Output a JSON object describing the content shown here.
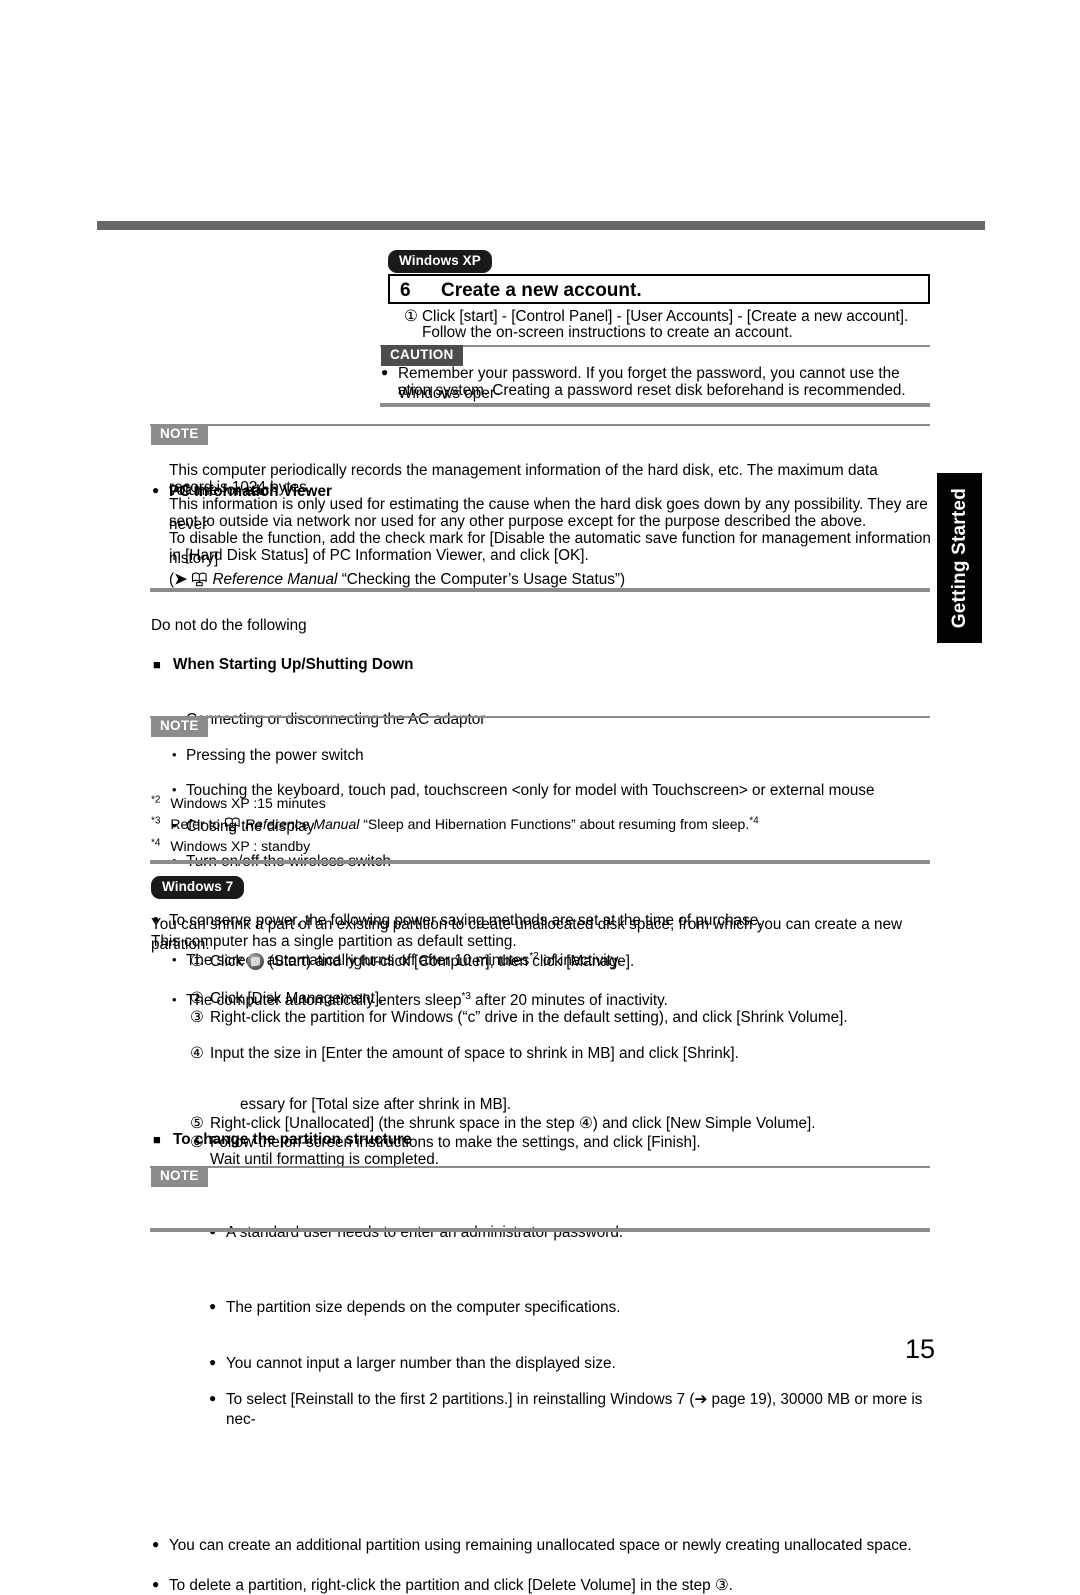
{
  "document": {
    "page_number": "15",
    "side_tab": "Getting Started"
  },
  "section_xp": {
    "os_badge": "Windows XP",
    "step_number": "6",
    "step_title": "Create a new account.",
    "items": [
      "Click [start] - [Control Panel] - [User Accounts] - [Create a new account].",
      "Follow the on-screen instructions to create an account."
    ],
    "caution": {
      "tag": "CAUTION",
      "lines": [
        "Remember your password. If you forget the password, you cannot use the Windows oper-",
        "ation system. Creating a password reset disk beforehand is recommended."
      ]
    }
  },
  "note_pcinfo": {
    "tag": "NOTE",
    "heading": "PC Information Viewer",
    "paragraphs": [
      "This computer periodically records the management information of the hard disk, etc. The maximum data volume for each",
      "record is 1024 bytes.",
      "This information is only used for estimating the cause when the hard disk goes down by any possibility. They are never",
      "sent to outside via network nor used for any other purpose except for the purpose described the above.",
      "To disable the function, add the check mark for [Disable the automatic save function for management information history]",
      "in [Hard Disk Status] of PC Information Viewer, and click [OK]."
    ],
    "reference_prefix": "(",
    "reference_manual": "Reference Manual",
    "reference_suffix": "“Checking the Computer’s Usage Status”)"
  },
  "startup_shutdown": {
    "heading": "When Starting Up/Shutting Down",
    "intro": "Do not do the following",
    "items": [
      "Connecting or disconnecting the AC adaptor",
      "Pressing the power switch",
      "Touching the keyboard, touch pad, touchscreen <only for model with Touchscreen> or external mouse",
      "Closing the display",
      "Turn on/off the wireless switch"
    ]
  },
  "note_power": {
    "tag": "NOTE",
    "lead": "To conserve power, the following power saving methods are set at the time of purchase.",
    "items": [
      {
        "before": "The screen automatically turns off after 10 minutes",
        "sup": "*2",
        "after": " of inactivity."
      },
      {
        "before": "The computer automatically enters sleep",
        "sup": "*3",
        "after": " after 20 minutes of inactivity."
      }
    ],
    "footnotes": [
      {
        "marker": "*2",
        "text": "Windows XP :15 minutes"
      },
      {
        "marker": "*3",
        "text_before": "Refer to ",
        "manual": "Reference Manual",
        "text_after": "“Sleep and Hibernation Functions” about resuming from sleep.",
        "sup": "*4"
      },
      {
        "marker": "*4",
        "text": "Windows XP : standby"
      }
    ]
  },
  "section_win7": {
    "os_badge": "Windows 7",
    "heading": "To change the partition structure",
    "intro": [
      "You can shrink a part of an existing partition to create unallocated disk space, from which you can create a new partition.",
      "This computer has a single partition as default setting."
    ],
    "steps": [
      {
        "marker": "①",
        "text_before": "Click ",
        "has_orb": true,
        "text_after": " (Start) and right-click [Computer], then click [Manage].",
        "subs": [
          "A standard user needs to enter an administrator password."
        ]
      },
      {
        "marker": "②",
        "text_before": "Click [Disk Management].",
        "has_orb": false,
        "text_after": "",
        "subs": []
      },
      {
        "marker": "③",
        "text_before": "Right-click the partition for Windows (“c” drive in the default setting), and click [Shrink Volume].",
        "has_orb": false,
        "text_after": "",
        "subs": [
          "The partition size depends on the computer specifications."
        ]
      },
      {
        "marker": "④",
        "text_before": "Input the size in [Enter the amount of space to shrink in MB] and click [Shrink].",
        "has_orb": false,
        "text_after": "",
        "subs": [
          "You cannot input a larger number than the displayed size.",
          "To select [Reinstall to the first 2 partitions.] in reinstalling Windows 7 (➔ page 19), 30000 MB or more is nec-",
          "essary for [Total size after shrink in MB]."
        ]
      },
      {
        "marker": "⑤",
        "text_before": "Right-click [Unallocated] (the shrunk space in the step ④) and click [New Simple Volume].",
        "has_orb": false,
        "text_after": "",
        "subs": []
      },
      {
        "marker": "⑥",
        "text_before": "Follow the on-screen instructions to make the settings, and click [Finish].",
        "has_orb": false,
        "text_after": "",
        "subs": []
      }
    ],
    "step6_second_line": "Wait until formatting is completed."
  },
  "note_partition": {
    "tag": "NOTE",
    "items": [
      "You can create an additional partition using remaining unallocated space or newly creating unallocated space.",
      "To delete a partition, right-click the partition and click [Delete Volume] in the step ③."
    ]
  }
}
